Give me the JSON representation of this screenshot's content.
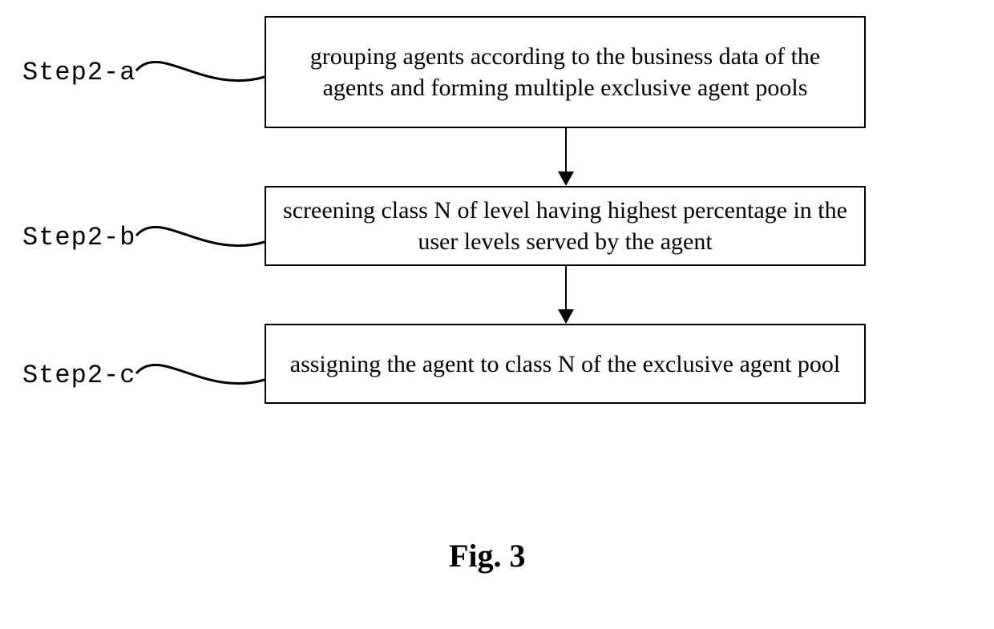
{
  "steps": {
    "a": {
      "label": "Step2-a",
      "text": "grouping agents according to the business data of the agents and forming multiple exclusive agent pools"
    },
    "b": {
      "label": "Step2-b",
      "text": "screening class N of level having highest percentage in the user levels served by the agent"
    },
    "c": {
      "label": "Step2-c",
      "text": "assigning the agent to class N of the exclusive agent pool"
    }
  },
  "figure_label": "Fig. 3",
  "chart_data": {
    "type": "flowchart",
    "nodes": [
      {
        "id": "Step2-a",
        "text": "grouping agents according to the business data of the agents and forming multiple exclusive agent pools"
      },
      {
        "id": "Step2-b",
        "text": "screening class N of level having highest percentage in the user levels served by the agent"
      },
      {
        "id": "Step2-c",
        "text": "assigning the agent to class N of the exclusive agent pool"
      }
    ],
    "edges": [
      {
        "from": "Step2-a",
        "to": "Step2-b"
      },
      {
        "from": "Step2-b",
        "to": "Step2-c"
      }
    ],
    "title": "Fig. 3"
  }
}
